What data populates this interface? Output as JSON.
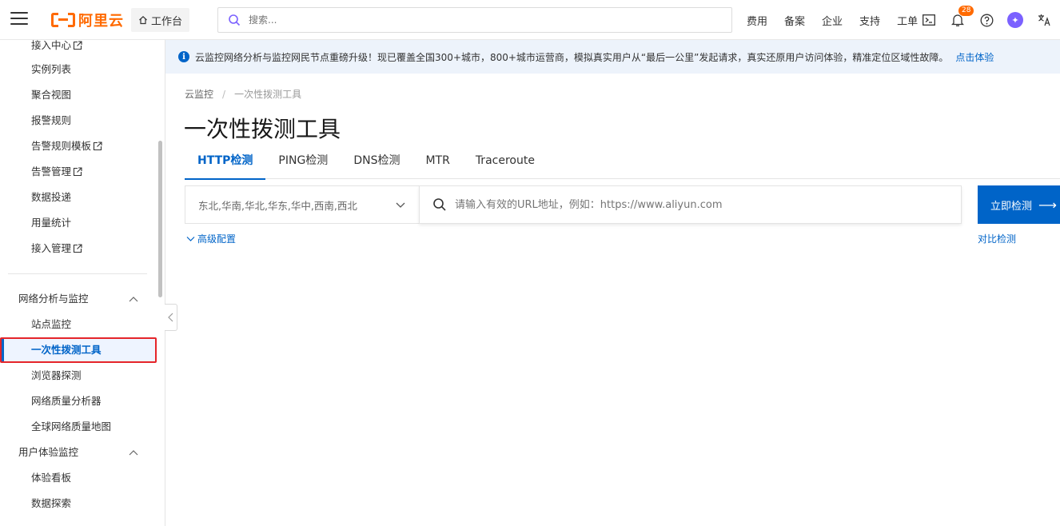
{
  "header": {
    "logo_text": "阿里云",
    "workbench_label": "工作台",
    "search_placeholder": "搜索...",
    "links": [
      "费用",
      "备案",
      "企业",
      "支持",
      "工单"
    ],
    "notification_count": "28",
    "avatar_initial": "✦",
    "brand_color": "#ff6a00"
  },
  "sidebar": {
    "items_top": [
      {
        "label": "接入中心",
        "external": true
      },
      {
        "label": "实例列表",
        "external": false
      },
      {
        "label": "聚合视图",
        "external": false
      },
      {
        "label": "报警规则",
        "external": false
      },
      {
        "label": "告警规则模板",
        "external": true
      },
      {
        "label": "告警管理",
        "external": true
      },
      {
        "label": "数据投递",
        "external": false
      },
      {
        "label": "用量统计",
        "external": false
      },
      {
        "label": "接入管理",
        "external": true
      }
    ],
    "group_network": "网络分析与监控",
    "network_items": [
      "站点监控",
      "一次性拨测工具",
      "浏览器探测",
      "网络质量分析器",
      "全球网络质量地图"
    ],
    "group_ux": "用户体验监控",
    "ux_items": [
      "体验看板",
      "数据探索"
    ],
    "active_item": "一次性拨测工具"
  },
  "notice": {
    "text": "云监控网络分析与监控网民节点重磅升级！现已覆盖全国300+城市，800+城市运营商，模拟真实用户从“最后一公里”发起请求，真实还原用户访问体验，精准定位区域性故障。",
    "link": "点击体验"
  },
  "breadcrumb": {
    "root": "云监控",
    "separator": "/",
    "current": "一次性拨测工具"
  },
  "page": {
    "title": "一次性拨测工具",
    "tabs": [
      "HTTP检测",
      "PING检测",
      "DNS检测",
      "MTR",
      "Traceroute"
    ],
    "active_tab": 0,
    "region_value": "东北,华南,华北,华东,华中,西南,西北",
    "url_placeholder": "请输入有效的URL地址，例如：https://www.aliyun.com",
    "run_button": "立即检测",
    "run_arrow": "⟶",
    "advanced_config": "高级配置",
    "compare_link": "对比检测",
    "accent_color": "#0064c8"
  }
}
